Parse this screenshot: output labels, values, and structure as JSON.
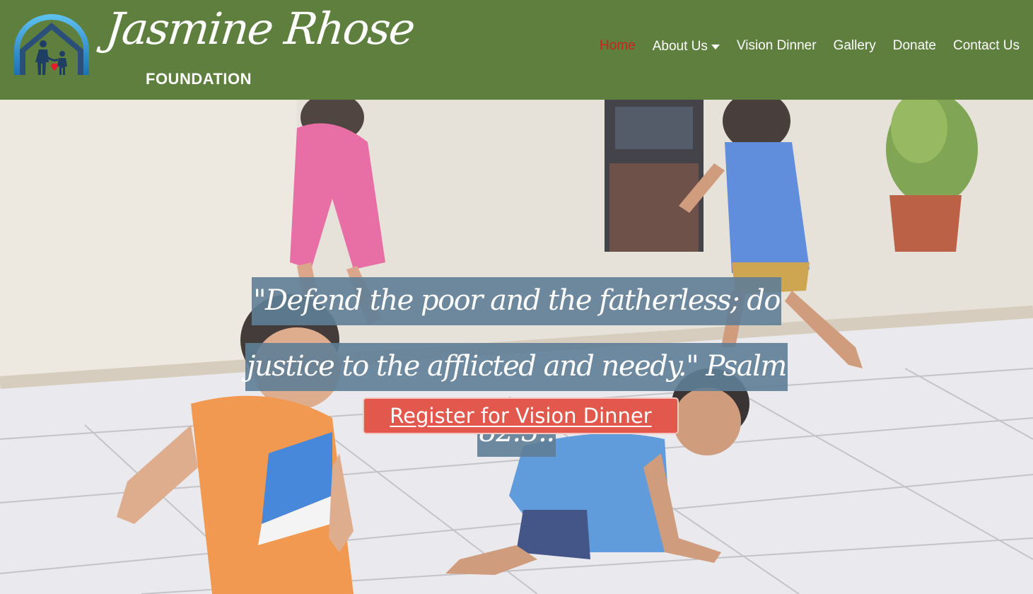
{
  "header": {
    "brand_script": "Jasmine Rhose",
    "brand_sub": "FOUNDATION",
    "logo_icon": "house-family-heart-icon",
    "background_color": "#5e7f3d"
  },
  "nav": {
    "items": [
      {
        "label": "Home",
        "active": true
      },
      {
        "label": "About Us",
        "has_dropdown": true
      },
      {
        "label": "Vision Dinner"
      },
      {
        "label": "Gallery"
      },
      {
        "label": "Donate"
      },
      {
        "label": "Contact Us"
      }
    ],
    "active_color": "#c8251c",
    "dropdown_icon": "caret-down-icon"
  },
  "hero": {
    "quote": "\"Defend the poor and the fatherless; do justice to the afflicted and needy.\" Psalm 82:3..",
    "cta_label": "Register for Vision Dinner",
    "cta_color": "#e3584c",
    "background_image": "children-playing-photo"
  }
}
